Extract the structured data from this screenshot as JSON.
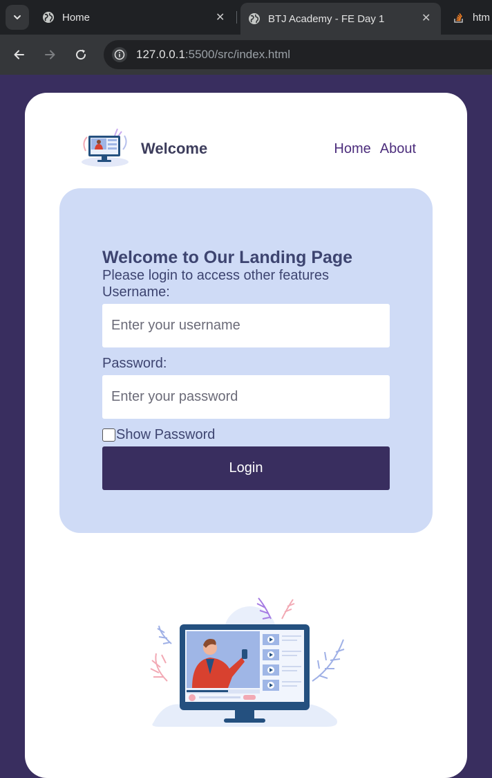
{
  "browser": {
    "tabs": [
      {
        "title": "Home"
      },
      {
        "title": "BTJ Academy - FE Day 1"
      },
      {
        "title": "htm"
      }
    ],
    "url": {
      "host": "127.0.0.1",
      "rest": ":5500/src/index.html"
    }
  },
  "header": {
    "brand": "Welcome",
    "nav": [
      {
        "label": "Home"
      },
      {
        "label": "About"
      }
    ]
  },
  "login": {
    "title": "Welcome to Our Landing Page",
    "subtitle": "Please login to access other features",
    "username_label": "Username:",
    "username_placeholder": "Enter your username",
    "password_label": "Password:",
    "password_placeholder": "Enter your password",
    "show_password_label": "Show Password",
    "show_password_checked": false,
    "button_label": "Login"
  },
  "colors": {
    "page_bg": "#392e5f",
    "panel_bg": "#cfdbf6",
    "button_bg": "#392e5f",
    "link": "#4c2d7c"
  },
  "icons": {
    "tab_menu": "chevron-down-icon",
    "tab_favicon": "globe-icon",
    "back": "arrow-left-icon",
    "forward": "arrow-right-icon",
    "reload": "reload-icon",
    "site_info": "info-icon"
  }
}
